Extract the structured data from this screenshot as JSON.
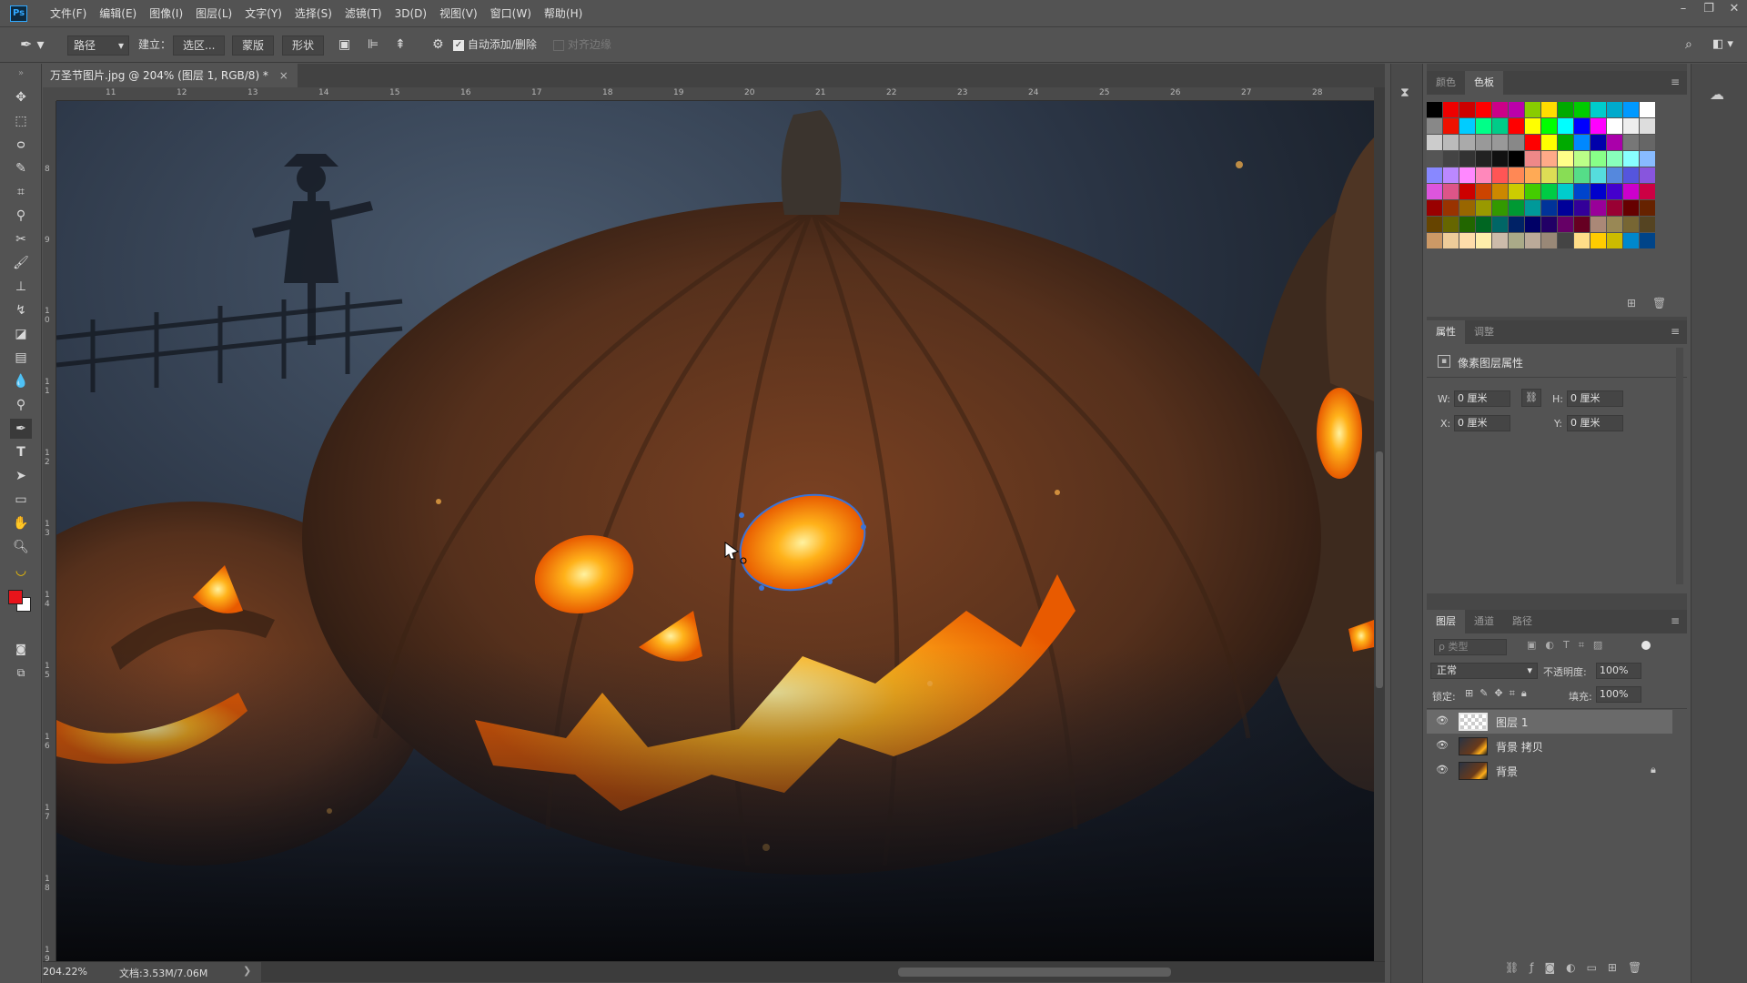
{
  "app": {
    "logo": "Ps"
  },
  "menu": [
    "文件(F)",
    "编辑(E)",
    "图像(I)",
    "图层(L)",
    "文字(Y)",
    "选择(S)",
    "滤镜(T)",
    "3D(D)",
    "视图(V)",
    "窗口(W)",
    "帮助(H)"
  ],
  "options": {
    "mode_select": "路径",
    "make_label": "建立：",
    "selection_button": "选区...",
    "mask_button": "蒙版",
    "shape_button": "形状",
    "auto_add_delete": "自动添加/删除",
    "auto_add_delete_checked": true,
    "align_edges": "对齐边缘"
  },
  "document": {
    "tab_title": "万圣节图片.jpg @ 204% (图层 1, RGB/8) *",
    "close": "×",
    "zoom": "204.22%",
    "doc_size": "文档:3.53M/7.06M"
  },
  "ruler": {
    "top": [
      "11",
      "12",
      "13",
      "14",
      "15",
      "16",
      "17",
      "18",
      "19",
      "20",
      "21",
      "22",
      "23",
      "24",
      "25",
      "26",
      "27",
      "28"
    ],
    "left": [
      "8",
      "9",
      "1 0",
      "1 1",
      "1 2",
      "1 3",
      "1 4",
      "1 5",
      "1 6",
      "1 7",
      "1 8",
      "1 9"
    ]
  },
  "swatch_panel": {
    "tabs": [
      "颜色",
      "色板"
    ],
    "active_tab": 1
  },
  "properties_panel": {
    "tabs": [
      "属性",
      "调整"
    ],
    "active_tab": 0,
    "title": "像素图层属性",
    "w_label": "W:",
    "w_value": "0 厘米",
    "h_label": "H:",
    "h_value": "0 厘米",
    "x_label": "X:",
    "x_value": "0 厘米",
    "y_label": "Y:",
    "y_value": "0 厘米"
  },
  "layers_panel": {
    "tabs": [
      "图层",
      "通道",
      "路径"
    ],
    "active_tab": 0,
    "filter_placeholder": "ρ 类型",
    "blend_mode": "正常",
    "opacity_label": "不透明度:",
    "opacity_value": "100%",
    "lock_label": "锁定:",
    "fill_label": "填充:",
    "fill_value": "100%",
    "layers": [
      {
        "name": "图层 1",
        "selected": true,
        "locked": false
      },
      {
        "name": "背景 拷贝",
        "selected": false,
        "locked": false
      },
      {
        "name": "背景",
        "selected": false,
        "locked": true
      }
    ]
  },
  "colors": {
    "foreground": "#e8141b",
    "background": "#ffffff",
    "accent": "#31a8ff"
  }
}
